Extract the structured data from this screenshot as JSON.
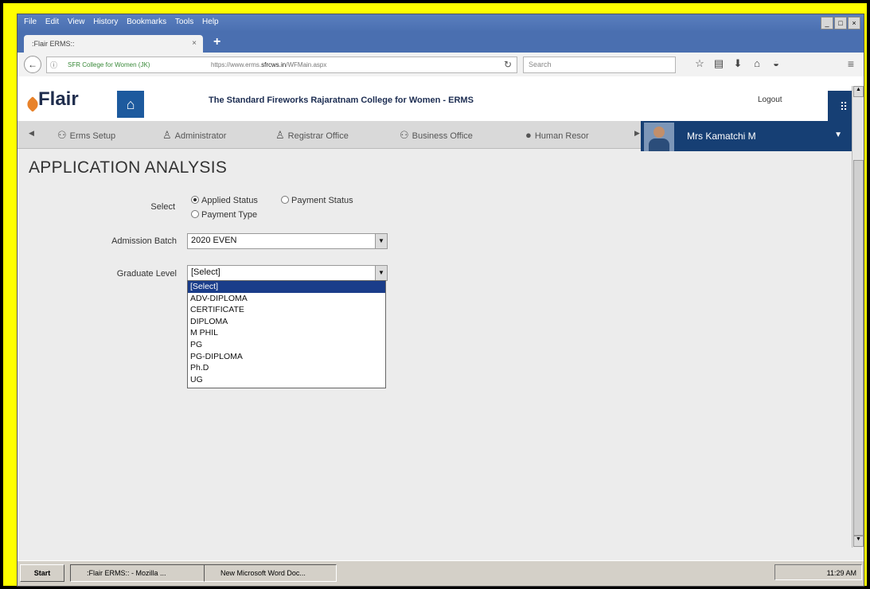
{
  "browser": {
    "menu": [
      "File",
      "Edit",
      "View",
      "History",
      "Bookmarks",
      "Tools",
      "Help"
    ],
    "tab_title": ":Flair ERMS::",
    "site_label": "SFR College for Women (JK)",
    "url_prefix": "https://www.erms.",
    "url_domain": "sfrcws.in",
    "url_rest": "/WFMain.aspx",
    "search_placeholder": "Search"
  },
  "app": {
    "logo_text": "Flair",
    "college_name": "The Standard Fireworks Rajaratnam College for Women - ERMS",
    "logout_label": "Logout",
    "modules": [
      "Erms Setup",
      "Administrator",
      "Registrar Office",
      "Business Office",
      "Human Resor"
    ],
    "user_name": "Mrs Kamatchi M"
  },
  "page": {
    "title": "APPLICATION ANALYSIS",
    "select_label": "Select",
    "radio_options": [
      "Applied Status",
      "Payment Status",
      "Payment Type"
    ],
    "selected_radio": "Applied Status",
    "admission_batch_label": "Admission Batch",
    "admission_batch_value": "2020 EVEN",
    "graduate_level_label": "Graduate Level",
    "graduate_level_value": "[Select]",
    "graduate_level_options": [
      "[Select]",
      "ADV-DIPLOMA",
      "CERTIFICATE",
      "DIPLOMA",
      "M PHIL",
      "PG",
      "PG-DIPLOMA",
      "Ph.D",
      "UG"
    ]
  },
  "taskbar": {
    "start_label": "Start",
    "tasks": [
      ":Flair ERMS:: - Mozilla ...",
      "New Microsoft Word Doc..."
    ],
    "time": "11:29 AM"
  }
}
